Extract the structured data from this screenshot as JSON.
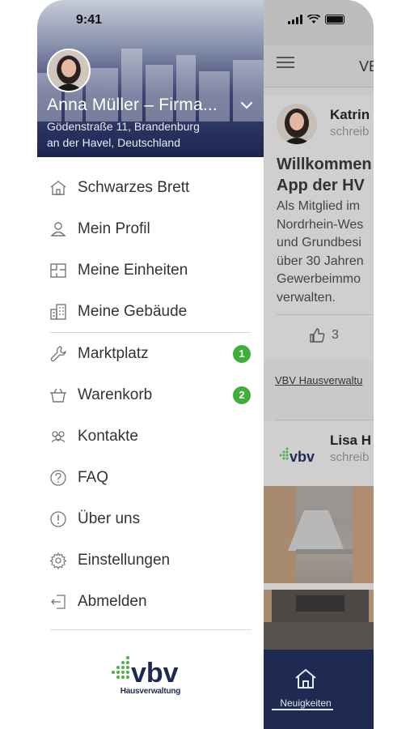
{
  "status_bar": {
    "time": "9:41"
  },
  "profile": {
    "name": "Anna Müller – Firma...",
    "address": "Gödenstraße 11, Brandenburg\nan der Havel, Deutschland"
  },
  "menu": {
    "group1": [
      {
        "label": "Schwarzes Brett",
        "icon": "bulletin-board-icon"
      },
      {
        "label": "Mein Profil",
        "icon": "user-icon"
      },
      {
        "label": "Meine Einheiten",
        "icon": "floorplan-icon"
      },
      {
        "label": "Meine Gebäude",
        "icon": "building-icon"
      }
    ],
    "group2": [
      {
        "label": "Marktplatz",
        "icon": "wrench-icon",
        "badge": "1"
      },
      {
        "label": "Warenkorb",
        "icon": "basket-icon",
        "badge": "2"
      },
      {
        "label": "Kontakte",
        "icon": "contacts-icon"
      },
      {
        "label": "FAQ",
        "icon": "question-icon"
      },
      {
        "label": "Über uns",
        "icon": "info-icon"
      },
      {
        "label": "Einstellungen",
        "icon": "gear-icon"
      },
      {
        "label": "Abmelden",
        "icon": "logout-icon"
      }
    ]
  },
  "logo": {
    "text": "vbv",
    "subtitle": "Hausverwaltung"
  },
  "background_app": {
    "topbar_title": "VB",
    "post1": {
      "author": "Katrin",
      "subtitle": "schreib",
      "title": "Willkommen\nApp der HV",
      "text": "Als Mitglied im\nNordrhein-Wes\nund Grundbesi\nüber 30 Jahren\nGewerbeimmo\nverwalten.",
      "likes": "3"
    },
    "link": "VBV Hausverwaltu",
    "post2": {
      "author": "Lisa H",
      "subtitle": "schreib",
      "logo_text": "vbv"
    },
    "tab": {
      "label": "Neuigkeiten",
      "icon": "home-icon"
    }
  },
  "colors": {
    "header_navy": "#1c2552",
    "badge_green": "#3fae3b",
    "tabbar_navy": "#1f2a52"
  }
}
